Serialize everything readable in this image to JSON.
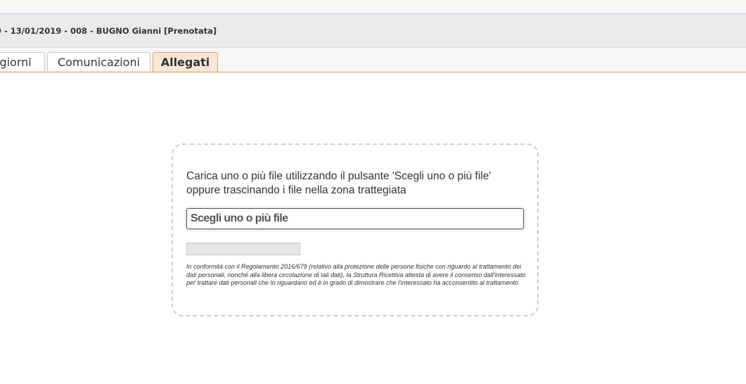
{
  "header": {
    "title": "9 - 13/01/2019 - 008 - BUGNO Gianni [Prenotata]"
  },
  "tabs": [
    {
      "label": "ggiorni",
      "active": false
    },
    {
      "label": "Comunicazioni",
      "active": false
    },
    {
      "label": "Allegati",
      "active": true
    }
  ],
  "upload": {
    "instructions_line1": "Carica uno o più file utilizzando il pulsante 'Scegli uno o più file'",
    "instructions_line2": "oppure trascinando i file nella zona trattegiata",
    "button_label": "Scegli uno o più file",
    "progress": 0,
    "disclaimer": "In conformità con il Regolamento 2016/679 (relativo alla protezione delle persone fisiche con riguardo al trattamento dei dati personali, nonché alla libera circolazione di tali dati), la Struttura Ricettiva attesta di avere il consenso dall'interessato per trattare dati personali che lo riguardano ed è in grado di dimostrare che l'interessato ha acconsentito al trattamento."
  },
  "colors": {
    "active_tab_bg": "#f6e7d8",
    "active_tab_border": "#d9a46a",
    "tabbar_underline": "#d59a4f"
  }
}
